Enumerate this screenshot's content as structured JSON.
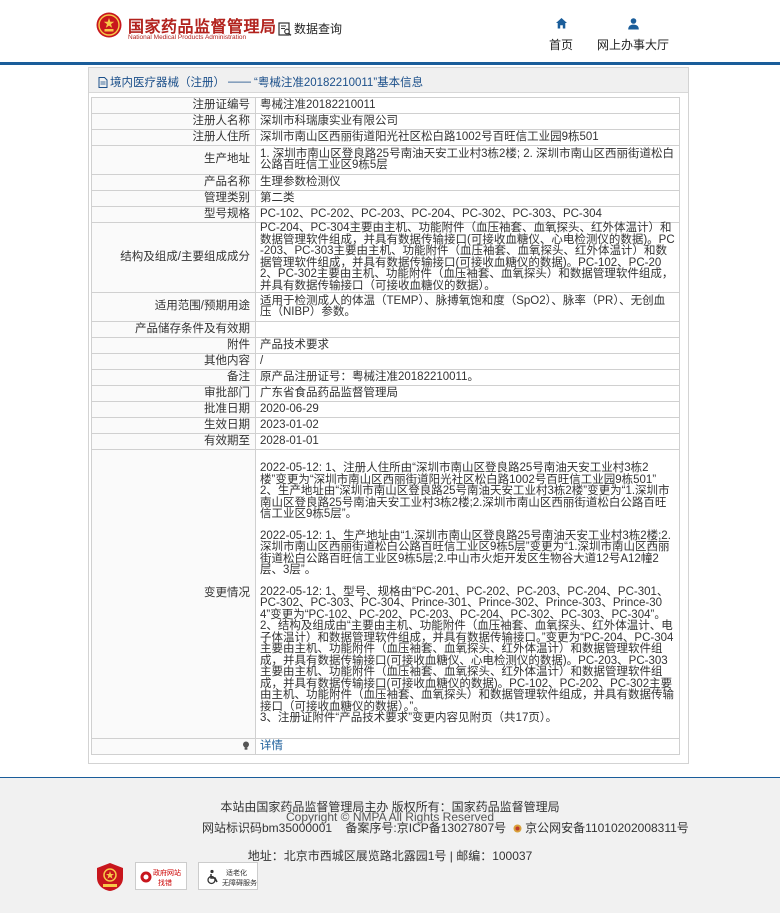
{
  "header": {
    "logo_cn": "国家药品监督管理局",
    "logo_en": "National Medical Products Administration",
    "data_query": "数据查询",
    "nav": [
      {
        "label": "首页",
        "icon": "home-icon"
      },
      {
        "label": "网上办事大厅",
        "icon": "user-icon"
      }
    ]
  },
  "breadcrumb": {
    "category": "境内医疗器械（注册）",
    "sep": "——",
    "title": "“粤械注准20182210011”基本信息"
  },
  "record": {
    "rows": [
      {
        "label": "注册证编号",
        "value": "粤械注准20182210011"
      },
      {
        "label": "注册人名称",
        "value": "深圳市科瑞康实业有限公司"
      },
      {
        "label": "注册人住所",
        "value": "深圳市南山区西丽街道阳光社区松白路1002号百旺信工业园9栋501"
      },
      {
        "label": "生产地址",
        "value": "1. 深圳市南山区登良路25号南油天安工业村3栋2楼; 2. 深圳市南山区西丽街道松白公路百旺信工业区9栋5层"
      },
      {
        "label": "产品名称",
        "value": "生理参数检测仪"
      },
      {
        "label": "管理类别",
        "value": "第二类"
      },
      {
        "label": "型号规格",
        "value": "PC-102、PC-202、PC-203、PC-204、PC-302、PC-303、PC-304"
      },
      {
        "label": "结构及组成/主要组成成分",
        "value": "PC-204、PC-304主要由主机、功能附件（血压袖套、血氧探头、红外体温计）和数据管理软件组成，并具有数据传输接口(可接收血糖仪、心电检测仪的数据)。PC-203、PC-303主要由主机、功能附件（血压袖套、血氧探头、红外体温计）和数据管理软件组成，并具有数据传输接口(可接收血糖仪的数据)。PC-102、PC-202、PC-302主要由主机、功能附件（血压袖套、血氧探头）和数据管理软件组成，并具有数据传输接口（可接收血糖仪的数据）。"
      },
      {
        "label": "适用范围/预期用途",
        "value": "适用于检测成人的体温（TEMP）、脉搏氧饱和度（SpO2）、脉率（PR）、无创血压（NIBP）参数。"
      },
      {
        "label": "产品储存条件及有效期",
        "value": ""
      },
      {
        "label": "附件",
        "value": "产品技术要求"
      },
      {
        "label": "其他内容",
        "value": "/"
      },
      {
        "label": "备注",
        "value": "原产品注册证号：粤械注准20182210011。"
      },
      {
        "label": "审批部门",
        "value": "广东省食品药品监督管理局"
      },
      {
        "label": "批准日期",
        "value": "2020-06-29"
      },
      {
        "label": "生效日期",
        "value": "2023-01-02"
      },
      {
        "label": "有效期至",
        "value": "2028-01-01"
      }
    ],
    "changes_label": "变更情况",
    "changes": [
      "2022-05-12: 1、注册人住所由“深圳市南山区登良路25号南油天安工业村3栋2楼”变更为“深圳市南山区西丽街道阳光社区松白路1002号百旺信工业园9栋501”\n2、生产地址由“深圳市南山区登良路25号南油天安工业村3栋2楼”变更为“1.深圳市南山区登良路25号南油天安工业村3栋2楼;2.深圳市南山区西丽街道松白公路百旺信工业区9栋5层”。",
      "2022-05-12: 1、生产地址由“1.深圳市南山区登良路25号南油天安工业村3栋2楼;2.深圳市南山区西丽街道松白公路百旺信工业区9栋5层”变更为“1.深圳市南山区西丽街道松白公路百旺信工业区9栋5层;2.中山市火炬开发区生物谷大道12号A12幢2层、3层”。",
      "2022-05-12: 1、型号、规格由“PC-201、PC-202、PC-203、PC-204、PC-301、PC-302、PC-303、PC-304、Prince-301、Prince-302、Prince-303、Prince-304”变更为“PC-102、PC-202、PC-203、PC-204、PC-302、PC-303、PC-304”。\n2、结构及组成由“主要由主机、功能附件（血压袖套、血氧探头、红外体温计、电子体温计）和数据管理软件组成，并具有数据传输接口。”变更为“PC-204、PC-304主要由主机、功能附件（血压袖套、血氧探头、红外体温计）和数据管理软件组成，并具有数据传输接口(可接收血糖仪、心电检测仪的数据)。PC-203、PC-303主要由主机、功能附件（血压袖套、血氧探头、红外体温计）和数据管理软件组成，并具有数据传输接口(可接收血糖仪的数据)。PC-102、PC-202、PC-302主要由主机、功能附件（血压袖套、血氧探头）和数据管理软件组成，并具有数据传输接口（可接收血糖仪的数据）。”。\n3、注册证附件“产品技术要求”变更内容见附页（共17页）。"
    ],
    "detail_link": "详情"
  },
  "footer": {
    "sponsor": "本站由国家药品监督管理局主办 版权所有：国家药品监督管理局",
    "copyright": "Copyright © NMPA All Rights Reserved",
    "site_id": "网站标识码bm35000001",
    "icp": "备案序号:京ICP备13027807号",
    "police": "京公网安备11010202008311号",
    "address": "地址：北京市西城区展览路北露园1号 | 邮编：100037",
    "badge_gov_1": "政府网站",
    "badge_gov_2": "找错",
    "badge_age_1": "适老化",
    "badge_age_2": "无障碍服务"
  },
  "colors": {
    "brand_red": "#b2221d",
    "brand_blue": "#1a5d9a"
  }
}
